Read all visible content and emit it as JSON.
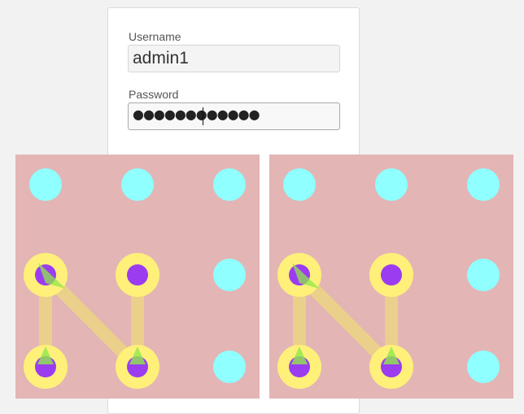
{
  "login": {
    "username_label": "Username",
    "username_value": "admin1",
    "password_label": "Password",
    "password_mask": "●●●●●●●●●●●●"
  },
  "pattern_panels": [
    {
      "selected_dots": [
        "middle-left",
        "middle-center",
        "bottom-left",
        "bottom-center"
      ],
      "path_order": [
        "bottom-left",
        "middle-left",
        "bottom-center",
        "middle-center"
      ]
    },
    {
      "selected_dots": [
        "middle-left",
        "middle-center",
        "bottom-left",
        "bottom-center"
      ],
      "path_order": [
        "bottom-left",
        "middle-left",
        "bottom-center",
        "middle-center"
      ]
    }
  ],
  "colors": {
    "panel_background": "#e3b5b5",
    "dot_idle": "#8fffff",
    "dot_selected_ring": "#fff07a",
    "dot_selected_core": "#9b3cf0",
    "path_line": "#ead08a",
    "direction_arrow": "#8ee84a"
  }
}
